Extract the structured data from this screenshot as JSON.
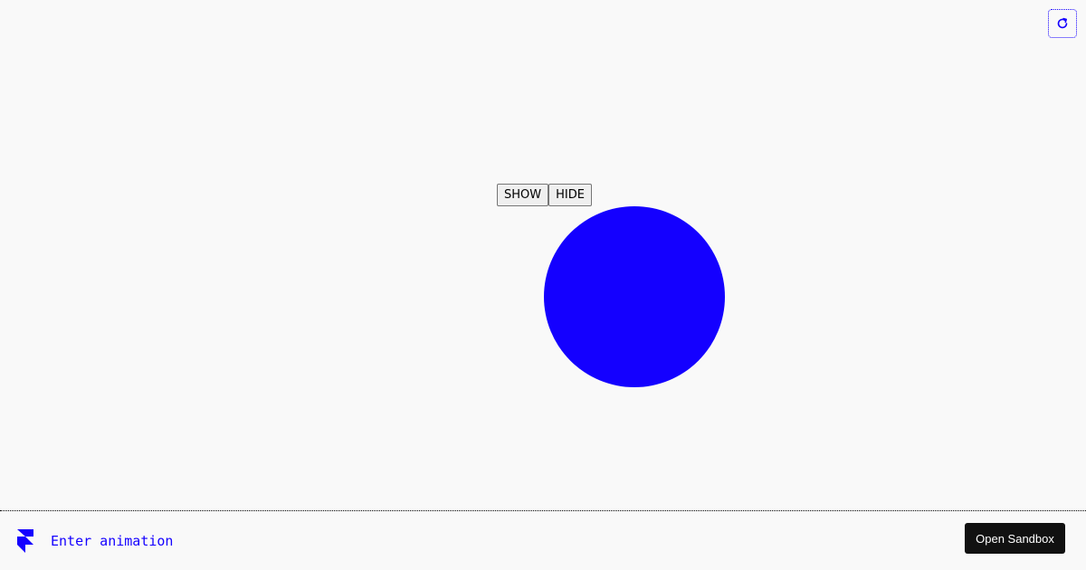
{
  "colors": {
    "accent": "#1400ff",
    "background": "#f9f9f9",
    "sandbox_button_bg": "#111111"
  },
  "stage": {
    "reload_icon": "refresh-icon",
    "controls": {
      "show_label": "SHOW",
      "hide_label": "HIDE"
    },
    "circle": {
      "color": "#1400ff"
    }
  },
  "footer": {
    "logo_icon": "framer-logo-icon",
    "title": "Enter animation",
    "open_sandbox_label": "Open Sandbox"
  }
}
